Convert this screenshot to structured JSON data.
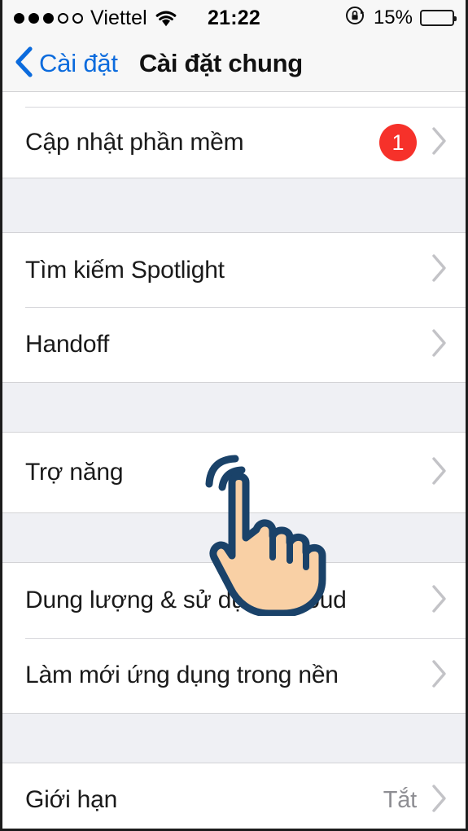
{
  "status_bar": {
    "signal_dots_filled": 3,
    "signal_dots_empty": 2,
    "carrier": "Viettel",
    "wifi_icon": "wifi-icon",
    "time": "21:22",
    "rotation_lock_icon": "rotation-lock-icon",
    "battery_percent_label": "15%",
    "battery_level": 15,
    "battery_color": "#f7231b"
  },
  "nav_bar": {
    "back_icon": "chevron-left-icon",
    "back_label": "Cài đặt",
    "title": "Cài đặt chung",
    "tint_color": "#0b6bdd"
  },
  "groups": [
    {
      "rows": [
        {
          "label": "Cập nhật phần mềm",
          "badge": "1",
          "badge_color": "#f6312a",
          "value": "",
          "chevron_icon": "chevron-right-icon"
        }
      ]
    },
    {
      "rows": [
        {
          "label": "Tìm kiếm Spotlight",
          "badge": "",
          "value": "",
          "chevron_icon": "chevron-right-icon"
        },
        {
          "label": "Handoff",
          "badge": "",
          "value": "",
          "chevron_icon": "chevron-right-icon"
        }
      ]
    },
    {
      "rows": [
        {
          "label": "Trợ năng",
          "badge": "",
          "value": "",
          "chevron_icon": "chevron-right-icon"
        }
      ]
    },
    {
      "rows": [
        {
          "label": "Dung lượng & sử dụng iCloud",
          "badge": "",
          "value": "",
          "chevron_icon": "chevron-right-icon"
        },
        {
          "label": "Làm mới ứng dụng trong nền",
          "badge": "",
          "value": "",
          "chevron_icon": "chevron-right-icon"
        }
      ]
    },
    {
      "rows": [
        {
          "label": "Giới hạn",
          "badge": "",
          "value": "Tắt",
          "chevron_icon": "chevron-right-icon"
        }
      ]
    }
  ],
  "cursor": {
    "icon": "tap-hand-cursor-icon",
    "outline_color": "#1a4269",
    "fill_color": "#f9d0a5"
  }
}
